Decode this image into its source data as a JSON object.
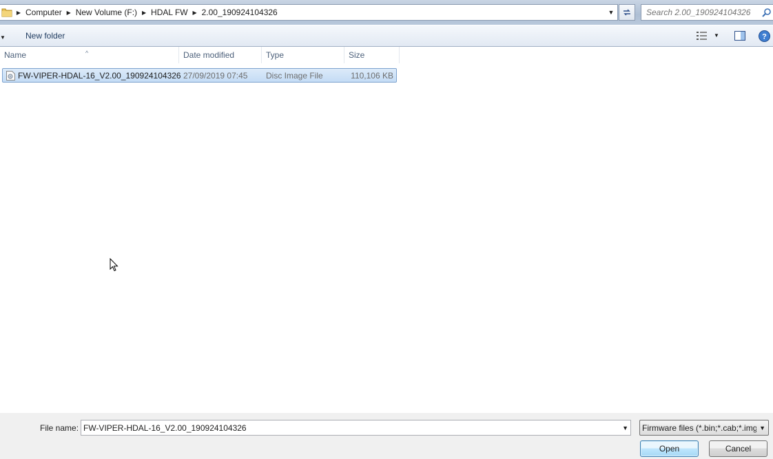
{
  "address_bar": {
    "crumbs": [
      "Computer",
      "New Volume (F:)",
      "HDAL FW",
      "2.00_190924104326"
    ],
    "icon": "folder-icon"
  },
  "search": {
    "placeholder": "Search 2.00_190924104326",
    "icon": "search-icon"
  },
  "toolbar": {
    "new_folder_label": "New folder",
    "icons": [
      "views-icon",
      "preview-pane-icon",
      "help-icon"
    ]
  },
  "columns": {
    "name": "Name",
    "date_modified": "Date modified",
    "type": "Type",
    "size": "Size"
  },
  "files": [
    {
      "name": "FW-VIPER-HDAL-16_V2.00_190924104326",
      "date_modified": "27/09/2019 07:45",
      "type": "Disc Image File",
      "size": "110,106 KB",
      "selected": true,
      "icon": "disc-image-file-icon"
    }
  ],
  "footer": {
    "file_name_label": "File name:",
    "file_name_value": "FW-VIPER-HDAL-16_V2.00_190924104326",
    "filter_value": "Firmware files (*.bin;*.cab;*.img",
    "open_label": "Open",
    "cancel_label": "Cancel"
  },
  "colors": {
    "selection_fill": "#c4dcf5",
    "selection_border": "#7da2ce",
    "header_text": "#4c607a"
  }
}
